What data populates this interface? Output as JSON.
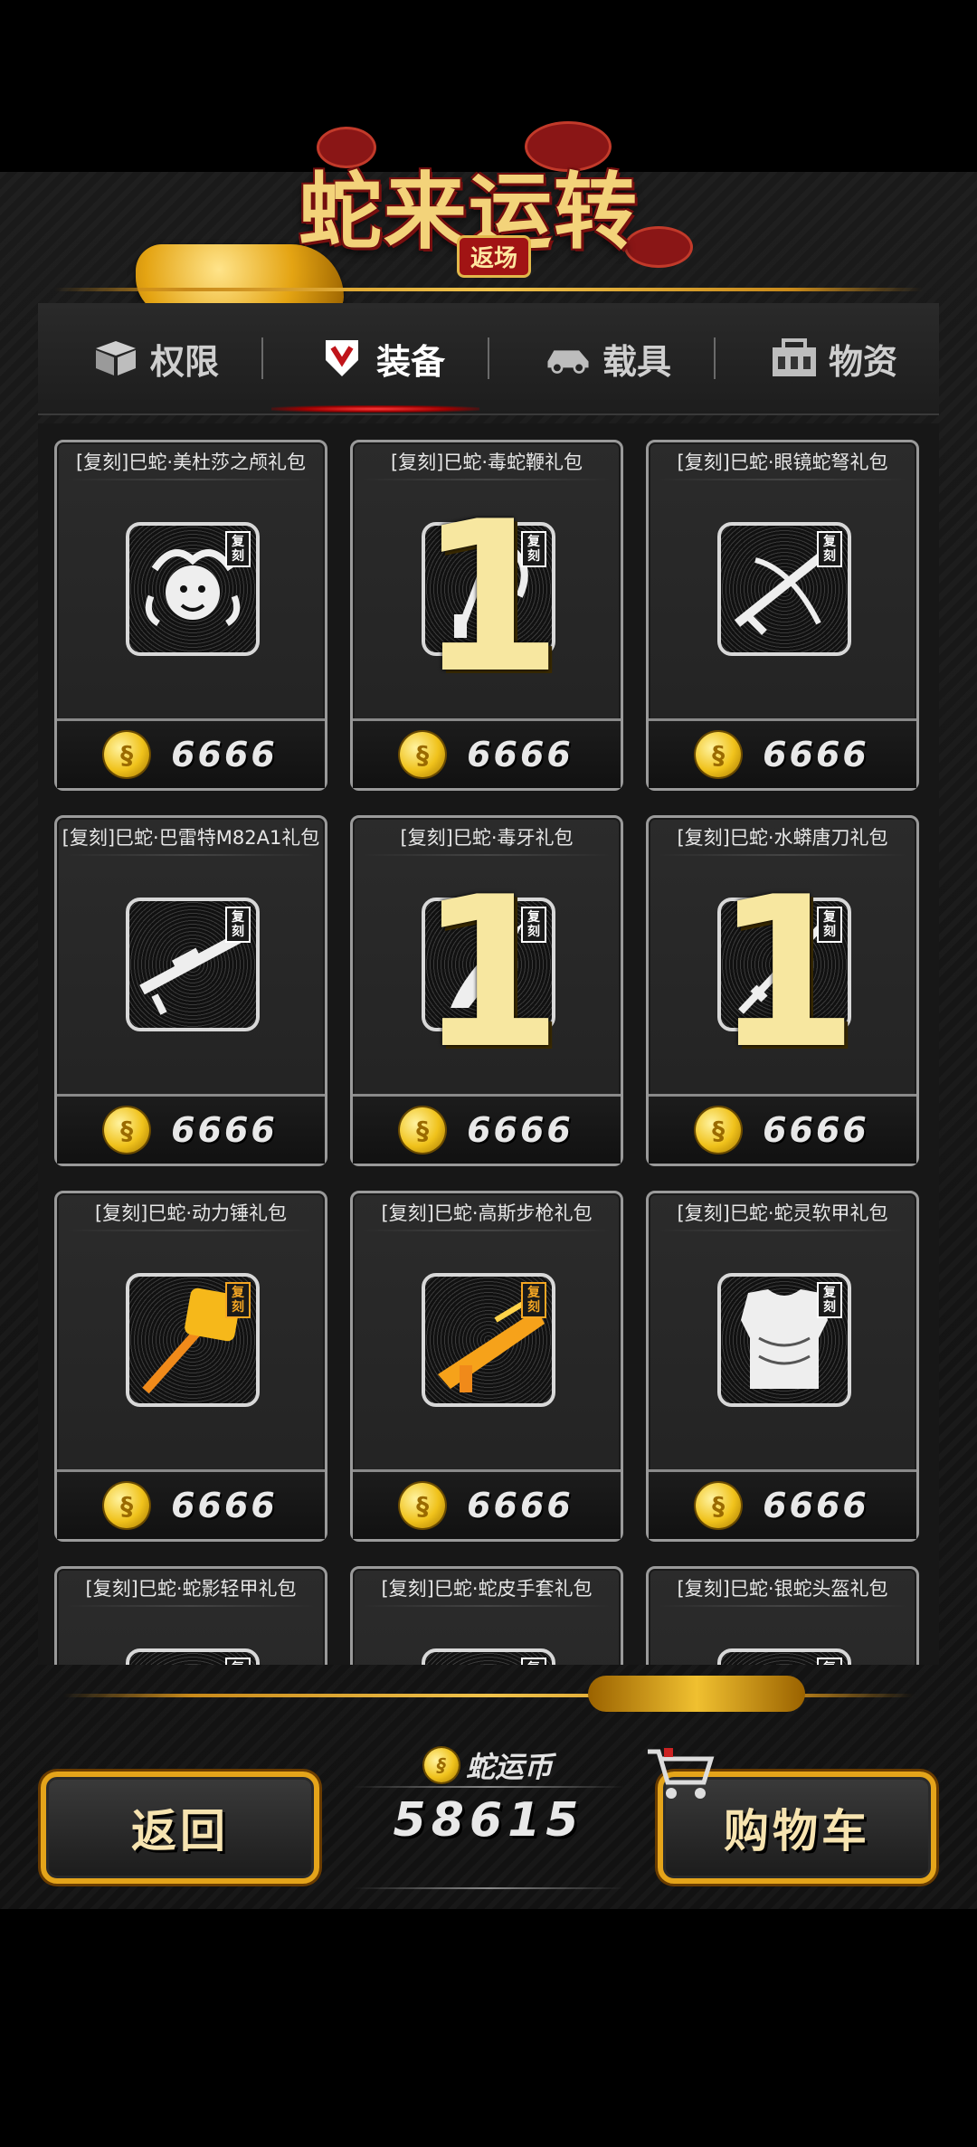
{
  "header": {
    "title": "蛇来运转",
    "subtitle": "返场"
  },
  "tabs": [
    {
      "label": "权限",
      "icon": "box-icon",
      "active": false
    },
    {
      "label": "装备",
      "icon": "armor-shield-icon",
      "active": true
    },
    {
      "label": "载具",
      "icon": "car-icon",
      "active": false
    },
    {
      "label": "物资",
      "icon": "supply-crate-icon",
      "active": false
    }
  ],
  "items": [
    {
      "name": "[复刻]巳蛇·美杜莎之颅礼包",
      "price": "6666",
      "icon": "medusa-head-icon",
      "tag": "复刻",
      "overlay": ""
    },
    {
      "name": "[复刻]巳蛇·毒蛇鞭礼包",
      "price": "6666",
      "icon": "snake-whip-icon",
      "tag": "复刻",
      "overlay": "1"
    },
    {
      "name": "[复刻]巳蛇·眼镜蛇弩礼包",
      "price": "6666",
      "icon": "crossbow-icon",
      "tag": "复刻",
      "overlay": ""
    },
    {
      "name": "[复刻]巳蛇·巴雷特M82A1礼包",
      "price": "6666",
      "icon": "sniper-rifle-icon",
      "tag": "复刻",
      "overlay": ""
    },
    {
      "name": "[复刻]巳蛇·毒牙礼包",
      "price": "6666",
      "icon": "fang-dagger-icon",
      "tag": "复刻",
      "overlay": "1"
    },
    {
      "name": "[复刻]巳蛇·水蟒唐刀礼包",
      "price": "6666",
      "icon": "katana-icon",
      "tag": "复刻",
      "overlay": "1"
    },
    {
      "name": "[复刻]巳蛇·动力锤礼包",
      "price": "6666",
      "icon": "power-hammer-icon",
      "tag": "复刻",
      "overlay": ""
    },
    {
      "name": "[复刻]巳蛇·高斯步枪礼包",
      "price": "6666",
      "icon": "gauss-rifle-icon",
      "tag": "复刻",
      "overlay": ""
    },
    {
      "name": "[复刻]巳蛇·蛇灵软甲礼包",
      "price": "6666",
      "icon": "soft-armor-vest-icon",
      "tag": "复刻",
      "overlay": ""
    },
    {
      "name": "[复刻]巳蛇·蛇影轻甲礼包",
      "price": "",
      "icon": "light-armor-icon",
      "tag": "复刻",
      "overlay": ""
    },
    {
      "name": "[复刻]巳蛇·蛇皮手套礼包",
      "price": "",
      "icon": "gloves-icon",
      "tag": "复刻",
      "overlay": ""
    },
    {
      "name": "[复刻]巳蛇·银蛇头盔礼包",
      "price": "",
      "icon": "helmet-icon",
      "tag": "复刻",
      "overlay": ""
    }
  ],
  "footer": {
    "back_label": "返回",
    "cart_label": "购物车",
    "currency_label": "蛇运币",
    "currency_value": "58615"
  },
  "colors": {
    "accent_gold": "#f0c21b",
    "tab_active_glow": "#ff3b3b",
    "card_border": "#9a9a9a"
  }
}
